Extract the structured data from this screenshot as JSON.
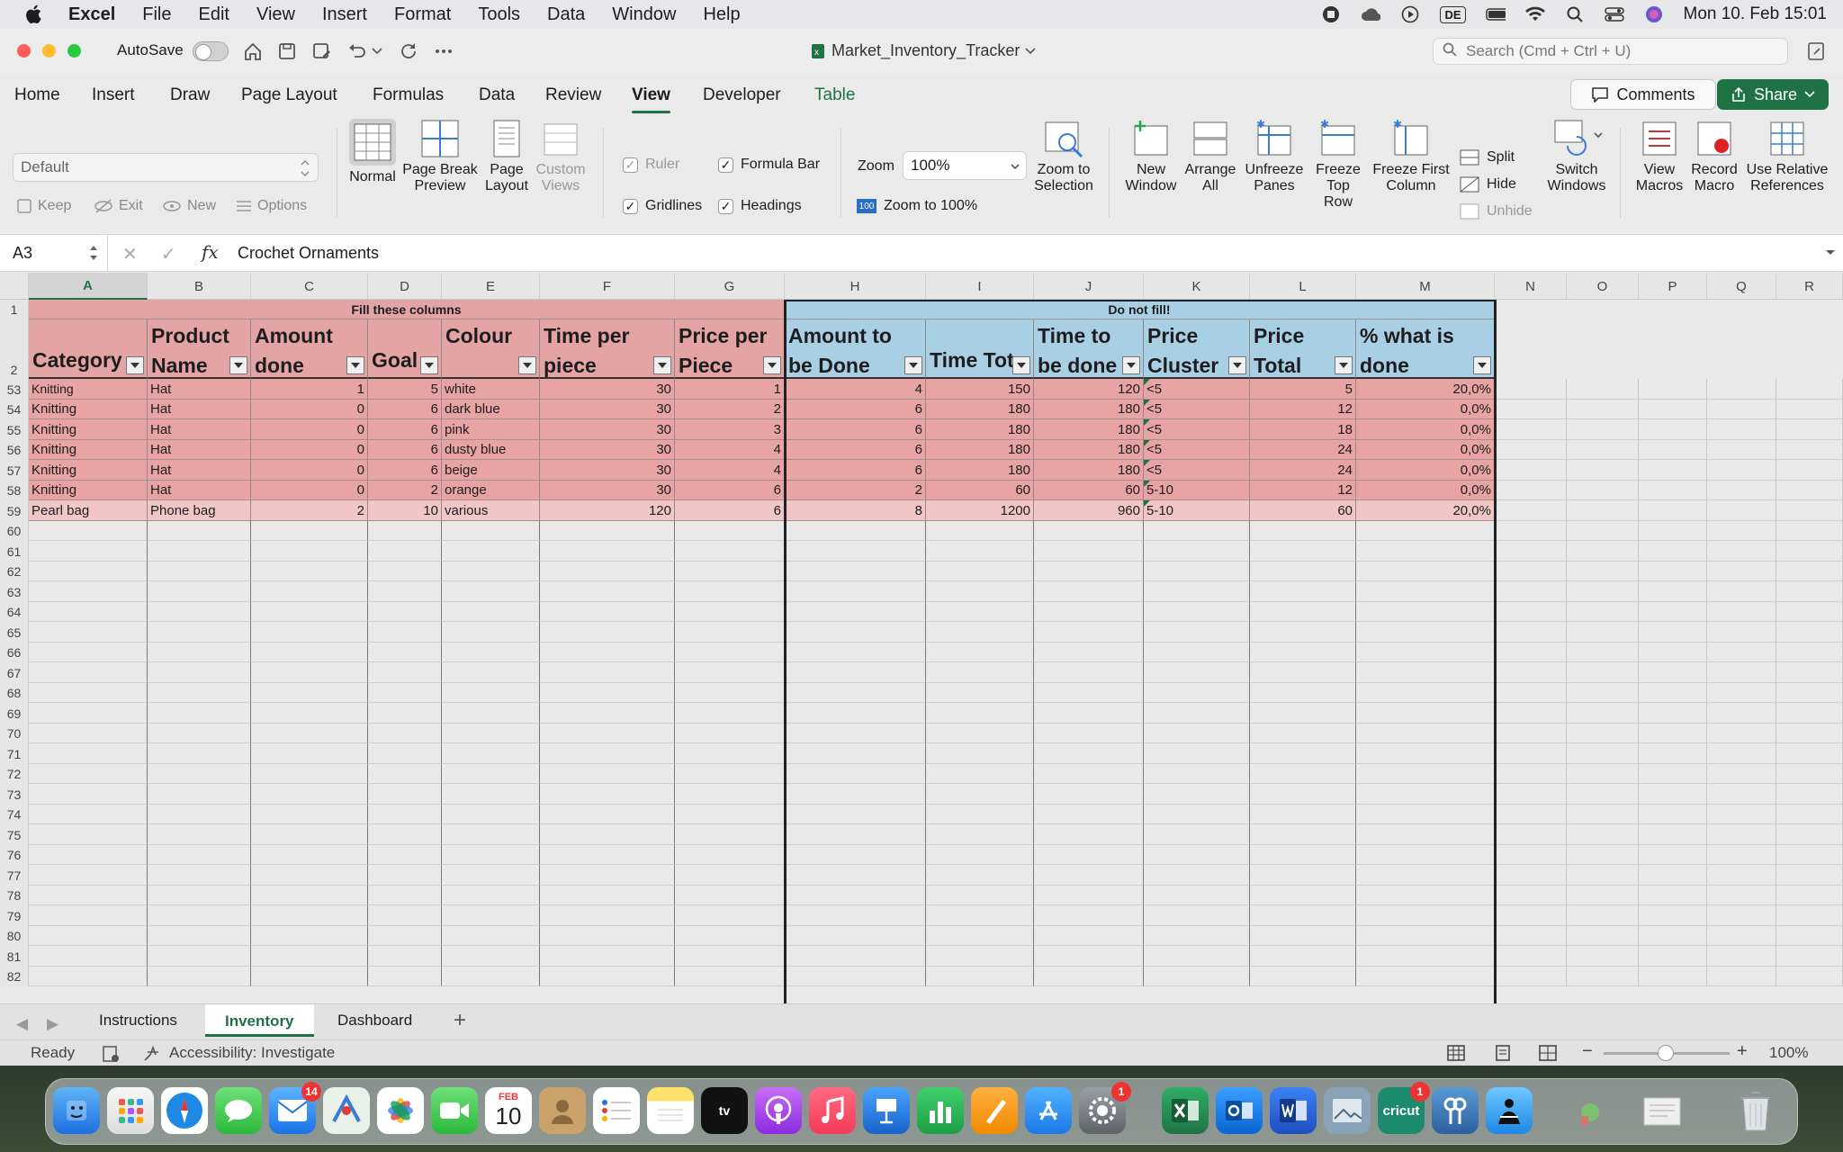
{
  "menubar": {
    "app": "Excel",
    "items": [
      "File",
      "Edit",
      "View",
      "Insert",
      "Format",
      "Tools",
      "Data",
      "Window",
      "Help"
    ],
    "input_source": "DE",
    "datetime": "Mon 10. Feb  15:01"
  },
  "titlebar": {
    "autosave_label": "AutoSave",
    "doc_title": "Market_Inventory_Tracker",
    "search_placeholder": "Search (Cmd + Ctrl + U)"
  },
  "ribbon_tabs": [
    "Home",
    "Insert",
    "Draw",
    "Page Layout",
    "Formulas",
    "Data",
    "Review",
    "View",
    "Developer",
    "Table"
  ],
  "ribbon_actions": {
    "comments": "Comments",
    "share": "Share"
  },
  "ribbon": {
    "sheet_view_value": "Default",
    "sheet_view_buttons": [
      "Keep",
      "Exit",
      "New",
      "Options"
    ],
    "workbook_views": [
      "Normal",
      "Page Break Preview",
      "Page Layout",
      "Custom Views"
    ],
    "show": {
      "ruler": "Ruler",
      "formula_bar": "Formula Bar",
      "gridlines": "Gridlines",
      "headings": "Headings"
    },
    "zoom_label": "Zoom",
    "zoom_value": "100%",
    "zoom_to_100": "Zoom to 100%",
    "zoom_to_selection": "Zoom to Selection",
    "window_buttons": [
      "New Window",
      "Arrange All",
      "Unfreeze Panes",
      "Freeze Top Row",
      "Freeze First Column"
    ],
    "split": "Split",
    "hide": "Hide",
    "unhide": "Unhide",
    "switch_windows": "Switch Windows",
    "macro_buttons": [
      "View Macros",
      "Record Macro",
      "Use Relative References"
    ]
  },
  "formula_bar": {
    "name_box": "A3",
    "fx": "fx",
    "formula": "Crochet Ornaments"
  },
  "grid": {
    "columns": [
      "A",
      "B",
      "C",
      "D",
      "E",
      "F",
      "G",
      "H",
      "I",
      "J",
      "K",
      "L",
      "M",
      "N",
      "O",
      "P",
      "Q",
      "R"
    ],
    "banner_left": "Fill these columns",
    "banner_right": "Do not fill!",
    "headers": [
      "Category",
      "Product Name",
      "Amount done",
      "Goal",
      "Colour",
      "Time per piece",
      "Price per Piece",
      "Amount to be Done",
      "Time Tot",
      "Time to be done",
      "Price Cluster",
      "Price Total",
      "% what is done"
    ],
    "rows": [
      {
        "n": "53",
        "cells": [
          "Knitting",
          "Hat",
          "1",
          "5",
          "white",
          "30",
          "1",
          "4",
          "150",
          "120",
          "<5",
          "5",
          "20,0%"
        ]
      },
      {
        "n": "54",
        "cells": [
          "Knitting",
          "Hat",
          "0",
          "6",
          "dark blue",
          "30",
          "2",
          "6",
          "180",
          "180",
          "<5",
          "12",
          "0,0%"
        ]
      },
      {
        "n": "55",
        "cells": [
          "Knitting",
          "Hat",
          "0",
          "6",
          "pink",
          "30",
          "3",
          "6",
          "180",
          "180",
          "<5",
          "18",
          "0,0%"
        ]
      },
      {
        "n": "56",
        "cells": [
          "Knitting",
          "Hat",
          "0",
          "6",
          "dusty blue",
          "30",
          "4",
          "6",
          "180",
          "180",
          "<5",
          "24",
          "0,0%"
        ]
      },
      {
        "n": "57",
        "cells": [
          "Knitting",
          "Hat",
          "0",
          "6",
          "beige",
          "30",
          "4",
          "6",
          "180",
          "180",
          "<5",
          "24",
          "0,0%"
        ]
      },
      {
        "n": "58",
        "cells": [
          "Knitting",
          "Hat",
          "0",
          "2",
          "orange",
          "30",
          "6",
          "2",
          "60",
          "60",
          "5-10",
          "12",
          "0,0%"
        ]
      },
      {
        "n": "59",
        "cells": [
          "Pearl bag",
          "Phone bag",
          "2",
          "10",
          "various",
          "120",
          "6",
          "8",
          "1200",
          "960",
          "5-10",
          "60",
          "20,0%"
        ]
      }
    ],
    "empty_rows": [
      "60",
      "61",
      "62",
      "63",
      "64",
      "65",
      "66",
      "67",
      "68",
      "69",
      "70",
      "71",
      "72",
      "73",
      "74",
      "75",
      "76",
      "77",
      "78",
      "79",
      "80",
      "81",
      "82"
    ],
    "row_header_1": "1",
    "row_header_2": "2"
  },
  "sheet_tabs": [
    "Instructions",
    "Inventory",
    "Dashboard"
  ],
  "status": {
    "ready": "Ready",
    "accessibility": "Accessibility: Investigate",
    "zoom": "100%"
  },
  "dock": {
    "mail_badge": "14",
    "calendar_month": "FEB",
    "calendar_day": "10",
    "settings_badge": "1",
    "cricut_badge": "1",
    "tv_label": "tv",
    "cricut_label": "cricut"
  },
  "colors": {
    "accent": "#1f7244",
    "fill_red": "#e8a3a3",
    "fill_red_light": "#f1c6c6",
    "header_blue": "#a9cfe4",
    "header_red": "#e5a4a4"
  }
}
